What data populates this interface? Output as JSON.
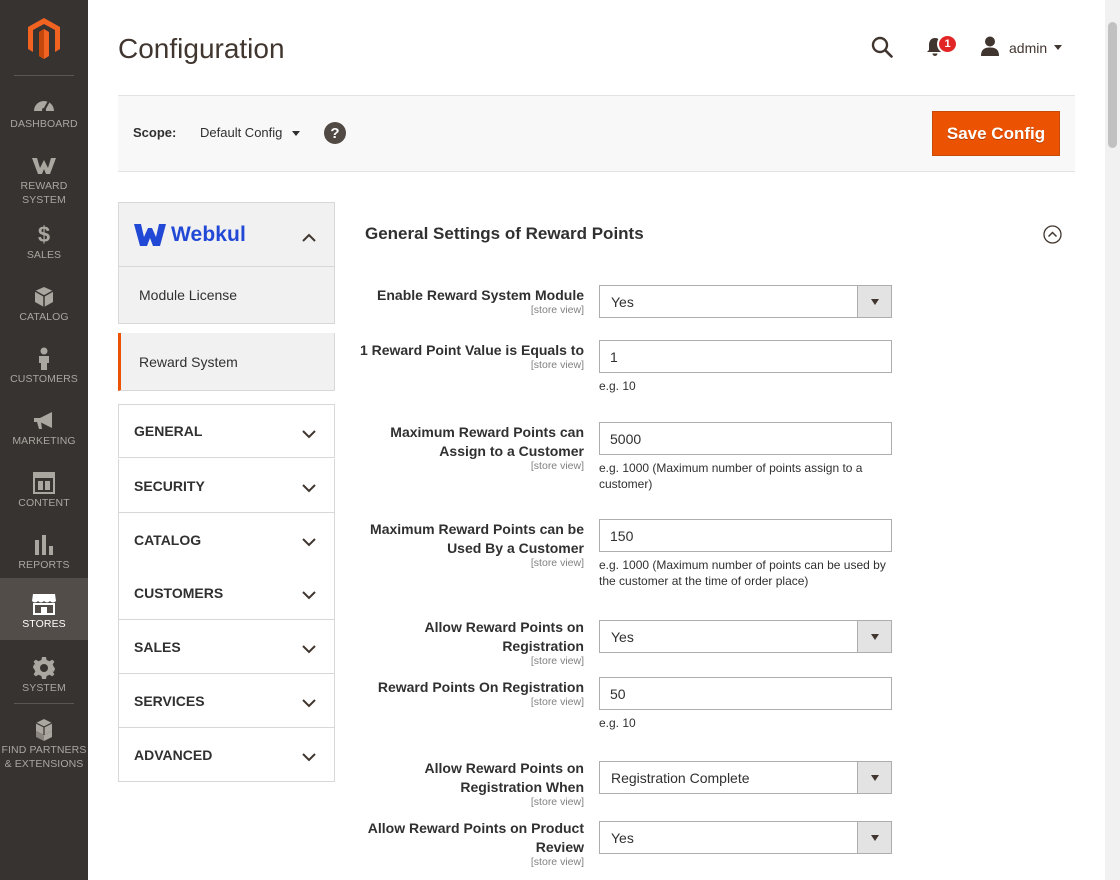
{
  "nav": {
    "items": [
      {
        "label": "DASHBOARD",
        "icon": "dashboard-icon"
      },
      {
        "label": "REWARD\nSYSTEM",
        "icon": "webkul-w-icon"
      },
      {
        "label": "SALES",
        "icon": "dollar-icon"
      },
      {
        "label": "CATALOG",
        "icon": "box-icon"
      },
      {
        "label": "CUSTOMERS",
        "icon": "person-icon"
      },
      {
        "label": "MARKETING",
        "icon": "megaphone-icon"
      },
      {
        "label": "CONTENT",
        "icon": "layout-icon"
      },
      {
        "label": "REPORTS",
        "icon": "bar-chart-icon"
      },
      {
        "label": "STORES",
        "icon": "store-icon"
      },
      {
        "label": "SYSTEM",
        "icon": "gear-icon"
      },
      {
        "label": "FIND PARTNERS\n& EXTENSIONS",
        "icon": "cubes-icon"
      }
    ],
    "active": "STORES",
    "accent_color": "#eb5202"
  },
  "header": {
    "title": "Configuration",
    "notification_count": "1",
    "user": "admin"
  },
  "scope": {
    "label": "Scope:",
    "value": "Default Config",
    "help": "?",
    "save_label": "Save Config"
  },
  "left_panel": {
    "brand": "Webkul",
    "sub_items": [
      "Module License",
      "Reward System"
    ],
    "sections": [
      "GENERAL",
      "SECURITY",
      "CATALOG",
      "CUSTOMERS",
      "SALES",
      "SERVICES",
      "ADVANCED"
    ]
  },
  "main": {
    "section_title": "General Settings of Reward Points",
    "scope_note": "[store view]",
    "fields": [
      {
        "label": "Enable Reward System Module",
        "type": "select",
        "value": "Yes"
      },
      {
        "label": "1 Reward Point Value is Equals to",
        "type": "input",
        "value": "1",
        "note": "e.g. 10"
      },
      {
        "label": "Maximum Reward Points can Assign to a Customer",
        "type": "input",
        "value": "5000",
        "note": "e.g. 1000 (Maximum number of points assign to a customer)"
      },
      {
        "label": "Maximum Reward Points can be Used By a Customer",
        "type": "input",
        "value": "150",
        "note": "e.g. 1000 (Maximum number of points can be used by the customer at the time of order place)"
      },
      {
        "label": "Allow Reward Points on Registration",
        "type": "select",
        "value": "Yes"
      },
      {
        "label": "Reward Points On Registration",
        "type": "input",
        "value": "50",
        "note": "e.g. 10"
      },
      {
        "label": "Allow Reward Points on Registration When",
        "type": "select",
        "value": "Registration Complete"
      },
      {
        "label": "Allow Reward Points on Product Review",
        "type": "select",
        "value": "Yes"
      }
    ]
  }
}
